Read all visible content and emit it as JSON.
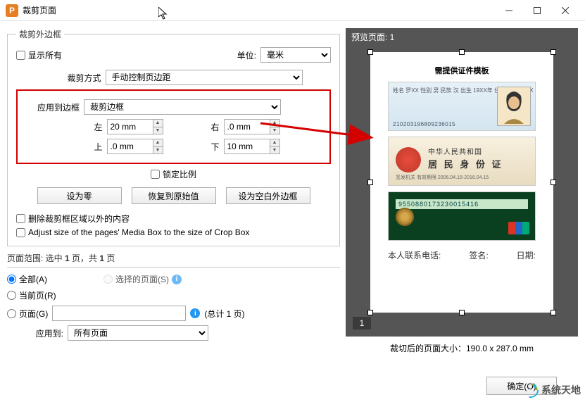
{
  "window": {
    "title": "裁剪页面",
    "app_icon_letter": "P"
  },
  "group": {
    "outer_margin": "裁剪外边框",
    "show_all": "显示所有",
    "unit_label": "单位:",
    "unit_value": "毫米",
    "crop_method_label": "裁剪方式",
    "crop_method_value": "手动控制页边距",
    "apply_frame_label": "应用到边框",
    "apply_frame_value": "裁剪边框",
    "left_label": "左",
    "left_value": "20 mm",
    "right_label": "右",
    "right_value": ".0 mm",
    "top_label": "上",
    "top_value": ".0 mm",
    "bottom_label": "下",
    "bottom_value": "10 mm",
    "lock_ratio": "锁定比例",
    "btn_zero": "设为零",
    "btn_restore": "恢复到原始值",
    "btn_blank": "设为空白外边框",
    "remove_outside": "删除裁剪框区域以外的内容",
    "adjust_media": "Adjust size of the pages' Media Box to the size of Crop Box"
  },
  "range": {
    "title_prefix": "页面范围: 选中 ",
    "title_bold1": "1",
    "title_mid": " 页，共 ",
    "title_bold2": "1",
    "title_suffix": " 页",
    "all": "全部(A)",
    "selected": "选择的页面(S)",
    "current": "当前页(R)",
    "pages": "页面(G)",
    "pages_value": "",
    "total": "(总计 1 页)",
    "apply_to_label": "应用到:",
    "apply_to_value": "所有页面"
  },
  "preview": {
    "header": "预览页面: 1",
    "doc_title": "需提供证件模板",
    "card1_lines": "姓名  罗XX\n性别  男  民族 汉\n出生  19XX年\n住址  XXXXXXX",
    "card1_barcode": "210203196809236015",
    "card2_line1": "中华人民共和国",
    "card2_line2": "居 民 身 份 证",
    "card2_line3": "签发机关        有效期限 2006.04.15-2016.04.15",
    "card3_num": "9550880173230015416",
    "footer_contact": "本人联系电话:",
    "footer_sign": "签名:",
    "footer_date": "日期:",
    "page_num": "1",
    "size_label": "裁切后的页面大小：190.0 x 287.0 mm"
  },
  "buttons": {
    "ok": "确定(O)"
  },
  "watermark": "系统天地"
}
